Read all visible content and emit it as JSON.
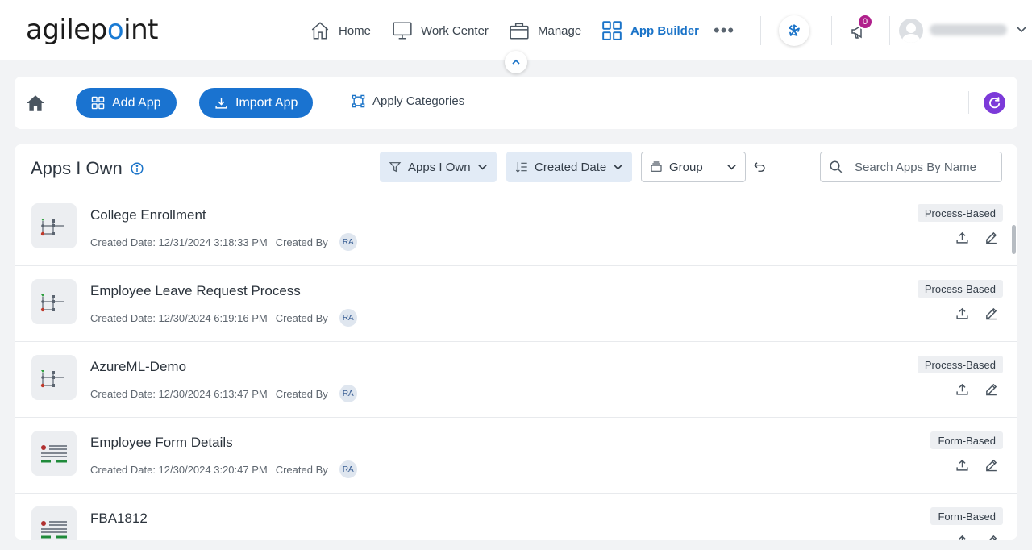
{
  "header": {
    "logo_text": "agilepoint",
    "nav": [
      {
        "label": "Home",
        "icon": "home-icon"
      },
      {
        "label": "Work Center",
        "icon": "monitor-icon"
      },
      {
        "label": "Manage",
        "icon": "briefcase-icon"
      },
      {
        "label": "App Builder",
        "icon": "grid-icon",
        "active": true
      }
    ],
    "more_label": "•••",
    "notification_count": "0"
  },
  "toolbar": {
    "add_app": "Add App",
    "import_app": "Import App",
    "apply_categories": "Apply Categories"
  },
  "panel": {
    "title": "Apps I Own",
    "filter_label": "Apps I Own",
    "sort_label": "Created Date",
    "group_label": "Group",
    "search_placeholder": "Search Apps By Name"
  },
  "apps": [
    {
      "name": "College Enrollment",
      "created": "Created Date: 12/31/2024 3:18:33 PM",
      "created_by": "Created By",
      "owner": "RA",
      "type": "Process-Based",
      "kind": "process"
    },
    {
      "name": "Employee Leave Request Process",
      "created": "Created Date: 12/30/2024 6:19:16 PM",
      "created_by": "Created By",
      "owner": "RA",
      "type": "Process-Based",
      "kind": "process"
    },
    {
      "name": "AzureML-Demo",
      "created": "Created Date: 12/30/2024 6:13:47 PM",
      "created_by": "Created By",
      "owner": "RA",
      "type": "Process-Based",
      "kind": "process"
    },
    {
      "name": "Employee Form Details",
      "created": "Created Date: 12/30/2024 3:20:47 PM",
      "created_by": "Created By",
      "owner": "RA",
      "type": "Form-Based",
      "kind": "form"
    },
    {
      "name": "FBA1812",
      "created": "",
      "created_by": "",
      "owner": "",
      "type": "Form-Based",
      "kind": "form"
    }
  ],
  "colors": {
    "primary": "#1a73d0",
    "accent_purple": "#7c3ad9",
    "badge": "#b0208c"
  }
}
